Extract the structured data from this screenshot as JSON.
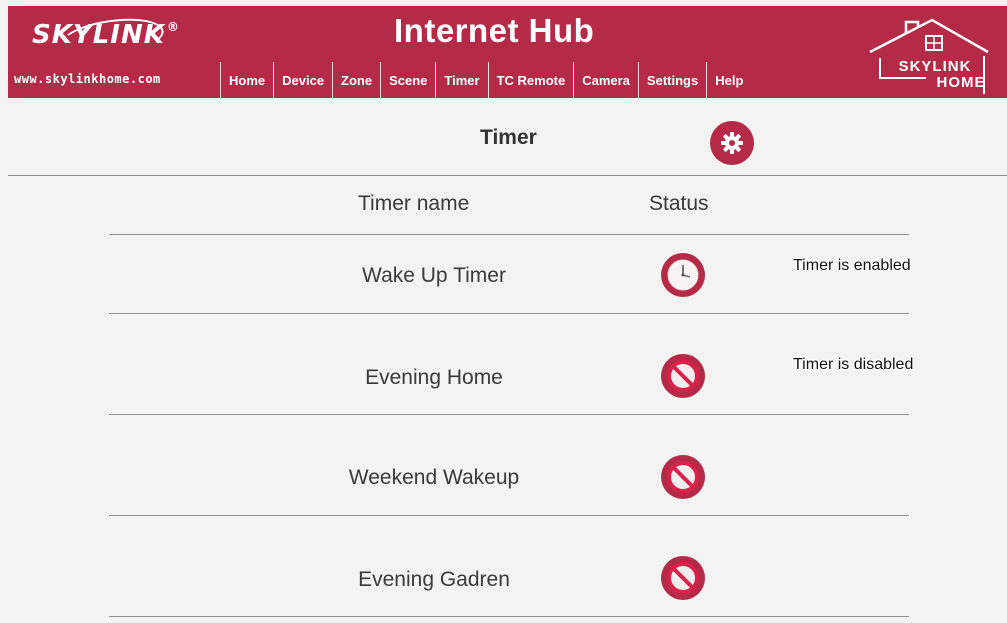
{
  "header": {
    "brand_name": "SKYLINK",
    "brand_registered": "®",
    "brand_url": "www.skylinkhome.com",
    "title": "Internet Hub",
    "home_logo_line1": "SKYLINK",
    "home_logo_line2": "HOME",
    "accent_color": "#b52a47"
  },
  "nav": {
    "items": [
      {
        "label": "Home"
      },
      {
        "label": "Device"
      },
      {
        "label": "Zone"
      },
      {
        "label": "Scene"
      },
      {
        "label": "Timer"
      },
      {
        "label": "TC Remote"
      },
      {
        "label": "Camera"
      },
      {
        "label": "Settings"
      },
      {
        "label": "Help"
      }
    ]
  },
  "page": {
    "title": "Timer",
    "settings_icon": "gear-icon"
  },
  "table": {
    "columns": [
      "Timer name",
      "Status"
    ],
    "rows": [
      {
        "name": "Wake Up Timer",
        "status": "enabled",
        "icon": "clock-icon"
      },
      {
        "name": "Evening Home",
        "status": "disabled",
        "icon": "disabled-icon"
      },
      {
        "name": "Weekend Wakeup",
        "status": "disabled",
        "icon": "disabled-icon"
      },
      {
        "name": "Evening Gadren",
        "status": "disabled",
        "icon": "disabled-icon"
      }
    ]
  },
  "annotations": {
    "enabled": "Timer is enabled",
    "disabled": "Timer is disabled"
  }
}
